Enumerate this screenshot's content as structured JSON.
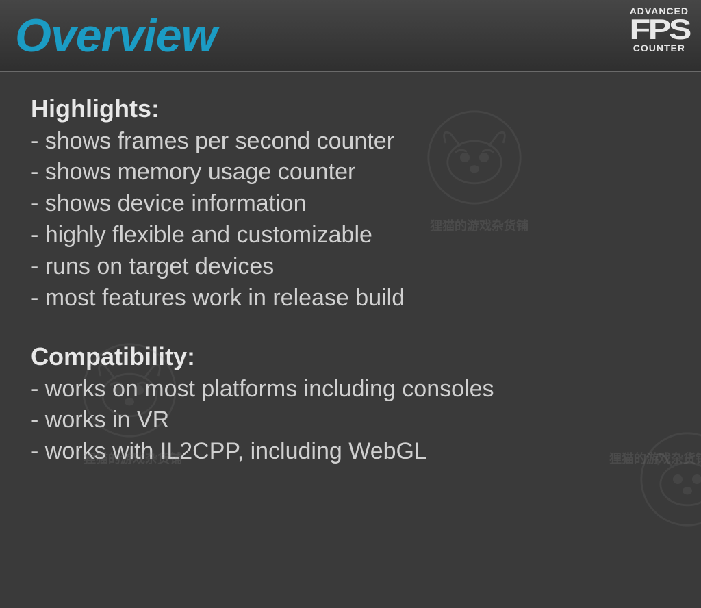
{
  "title": "Overview",
  "logo": {
    "top": "ADVANCED",
    "middle": "FPS",
    "bottom": "COUNTER"
  },
  "sections": {
    "highlights": {
      "heading": "Highlights:",
      "items": [
        "- shows frames per second counter",
        "- shows memory usage counter",
        "- shows device information",
        "- highly flexible and customizable",
        "- runs on target devices",
        "- most features work in release build"
      ]
    },
    "compat": {
      "heading": "Compatibility:",
      "items": [
        "- works on most platforms including consoles",
        "- works in VR",
        "- works with IL2CPP, including WebGL"
      ]
    }
  },
  "watermark_text": "狸猫的游戏杂货铺"
}
